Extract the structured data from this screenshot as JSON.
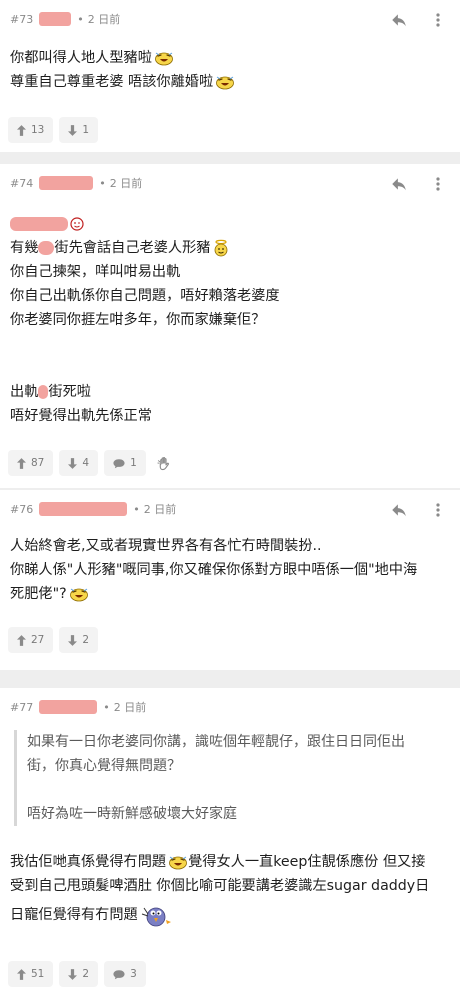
{
  "common": {
    "time": "2 日前"
  },
  "posts": [
    {
      "num": "#73",
      "lines": [
        "你都叫得人地人型豬啦",
        "尊重自己尊重老婆 唔該你離婚啦"
      ],
      "up": "13",
      "down": "1"
    },
    {
      "num": "#74",
      "line1_suffix": "有幾",
      "line1_tail": "街先會話自己老婆人形豬",
      "lines": [
        "你自己揀架，咩叫咁易出軌",
        "你自己出軌係你自己問題，唔好賴落老婆度",
        "你老婆同你捱左咁多年，你而家嫌棄佢？"
      ],
      "line_a": "出軌",
      "line_a_tail": "街死啦",
      "line_b": "唔好覺得出軌先係正常",
      "up": "87",
      "down": "4",
      "comments": "1"
    },
    {
      "num": "#76",
      "lines": [
        "人始終會老,又或者現實世界各有各忙冇時間裝扮..",
        "你睇人係\"人形豬\"嘅同事,你又確保你係對方眼中唔係一個\"地中海",
        "死肥佬\"?"
      ],
      "up": "27",
      "down": "2"
    },
    {
      "num": "#77",
      "quote_lines": [
        "如果有一日你老婆同你講，識咗個年輕靚仔，跟住日日同佢出",
        "街，你真心覺得無問題？",
        "唔好為咗一時新鮮感破壞大好家庭"
      ],
      "lines": [
        "我估佢哋真係覺得冇問題",
        "覺得女人一直keep住靚係應份 但又接",
        "受到自己甩頭髮啤酒肚 你個比喻可能要講老婆識左sugar daddy日",
        "日寵佢覺得有冇問題"
      ],
      "up": "51",
      "down": "2",
      "comments": "3"
    }
  ],
  "icons": {
    "reply": "reply-icon",
    "menu": "more-icon",
    "upvote": "arrow-up-icon",
    "downvote": "arrow-down-icon",
    "comment": "comment-icon",
    "hand": "hand-icon"
  },
  "colors": {
    "background": "#eeeeee",
    "card": "#ffffff",
    "redaction": "#f2a39f",
    "meta": "#8a8a8a"
  }
}
